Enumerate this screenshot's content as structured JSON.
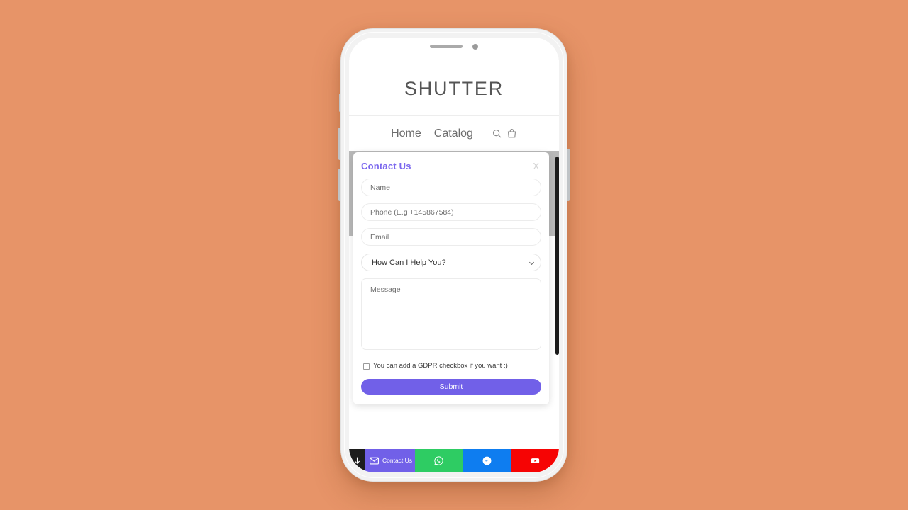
{
  "background": {
    "color": "#e79468"
  },
  "site": {
    "brand": "SHUTTER",
    "nav": {
      "links": [
        "Home",
        "Catalog"
      ],
      "icons": [
        "search-icon",
        "shopping-bag-icon"
      ]
    }
  },
  "modal": {
    "title": "Contact Us",
    "close_label": "X",
    "fields": {
      "name_placeholder": "Name",
      "phone_placeholder": "Phone (E.g +145867584)",
      "email_placeholder": "Email",
      "subject_selected": "How Can I Help You?",
      "message_placeholder": "Message"
    },
    "gdpr_label": "You can add a GDPR checkbox if you want :)",
    "submit_label": "Submit",
    "accent_color": "#7160e8",
    "title_color": "#7b68ee"
  },
  "social_bar": {
    "toggle_icon": "arrow-down-icon",
    "items": [
      {
        "label": "Contact Us",
        "icon": "envelope-icon",
        "color": "#7160e8"
      },
      {
        "label": "WhatsApp",
        "icon": "whatsapp-icon",
        "color": "#2ecc63"
      },
      {
        "label": "Messenger",
        "icon": "messenger-icon",
        "color": "#0e7df0"
      },
      {
        "label": "YouTube",
        "icon": "youtube-icon",
        "color": "#f60404"
      }
    ]
  }
}
